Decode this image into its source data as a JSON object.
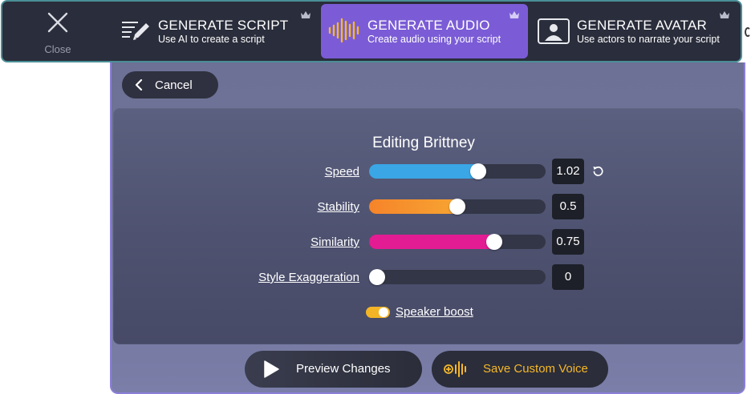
{
  "header": {
    "close_label": "Close",
    "tabs": [
      {
        "title": "GENERATE SCRIPT",
        "subtitle": "Use AI to create a script"
      },
      {
        "title": "GENERATE AUDIO",
        "subtitle": "Create audio using your script"
      },
      {
        "title": "GENERATE AVATAR",
        "subtitle": "Use actors to narrate your script"
      }
    ]
  },
  "cancel_label": "Cancel",
  "editor": {
    "title": "Editing Brittney",
    "sliders": [
      {
        "label": "Speed",
        "value": "1.02",
        "level": 0.63,
        "color": "#3aa6e6"
      },
      {
        "label": "Stability",
        "value": "0.5",
        "level": 0.5,
        "color": "#f7932f"
      },
      {
        "label": "Similarity",
        "value": "0.75",
        "level": 0.73,
        "color": "#e31c93"
      },
      {
        "label": "Style Exaggeration",
        "value": "0",
        "level": 0.0,
        "color": "#e31c93"
      }
    ],
    "speaker_boost_label": "Speaker boost",
    "speaker_boost_on": true
  },
  "actions": {
    "preview_label": "Preview Changes",
    "save_label": "Save Custom Voice"
  },
  "colors": {
    "accent": "#7b5cd6",
    "save_text": "#f5b82a",
    "toggle": "#f3b526"
  },
  "icons": {
    "close": "close-icon",
    "script": "pencil-lines-icon",
    "audio": "audio-waveform-icon",
    "avatar": "avatar-portrait-icon",
    "crown": "crown-icon",
    "reset": "reset-icon",
    "play": "play-icon",
    "save": "add-waveform-icon"
  }
}
